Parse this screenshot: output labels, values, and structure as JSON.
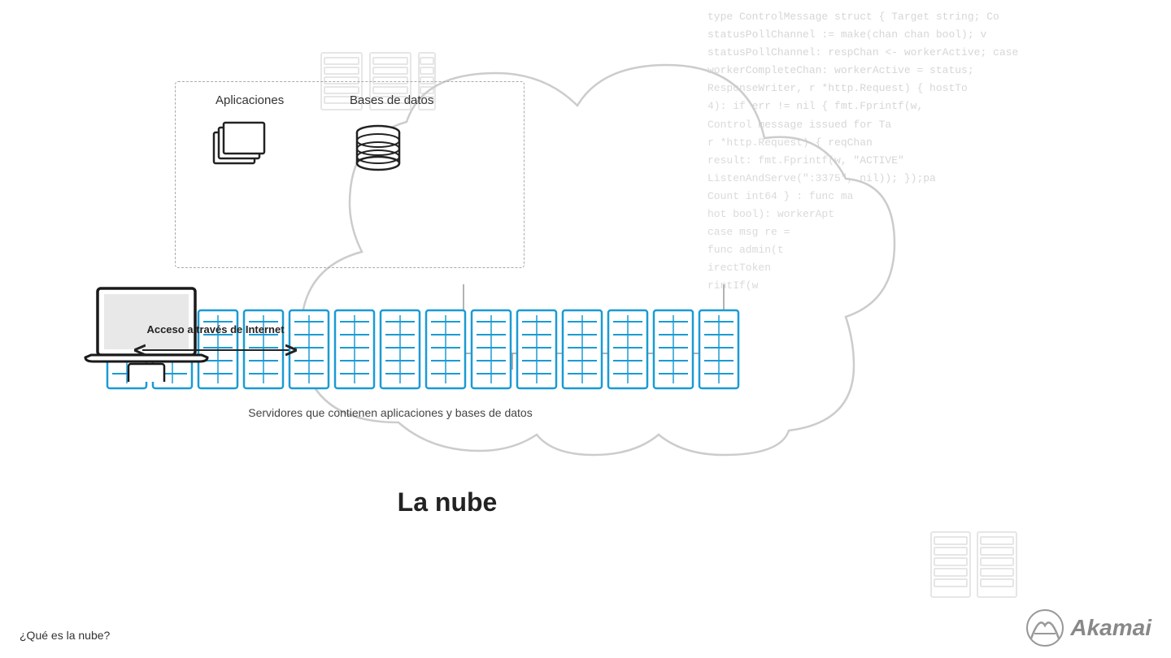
{
  "page": {
    "title": "La nube",
    "subtitle": "¿Qué es la nube?",
    "brand": "Akamai"
  },
  "diagram": {
    "cloud_title": "La nube",
    "app_label": "Aplicaciones",
    "db_label": "Bases de datos",
    "server_label": "Servidores que contienen aplicaciones y bases de datos",
    "arrow_text": "Acceso a través de Internet"
  },
  "code_lines": [
    "type ControlMessage struct { Target string; Co",
    "statusPollChannel := make(chan chan bool); v",
    "statusPollChannel: respChan <- workerActive; case",
    "workerCompleteChan: workerActive = status;",
    "ResponseWriter, r *http.Request) { hostTo",
    "4): if err != nil { fmt.Fprintf(w,",
    "Control message issued for Ta",
    "r *http.Request) { reqChan",
    "result: fmt.Fprintf(w, \"ACTIVE\"",
    "ListenAndServe(\":3375\", nil)); });pa",
    "Count int64 } : func ma",
    "hot bool): workerApt",
    "case msg re =",
    "func admin(t",
    "irectToken",
    "rintIf(w"
  ],
  "bottom_left": "¿Qué es la nube?"
}
